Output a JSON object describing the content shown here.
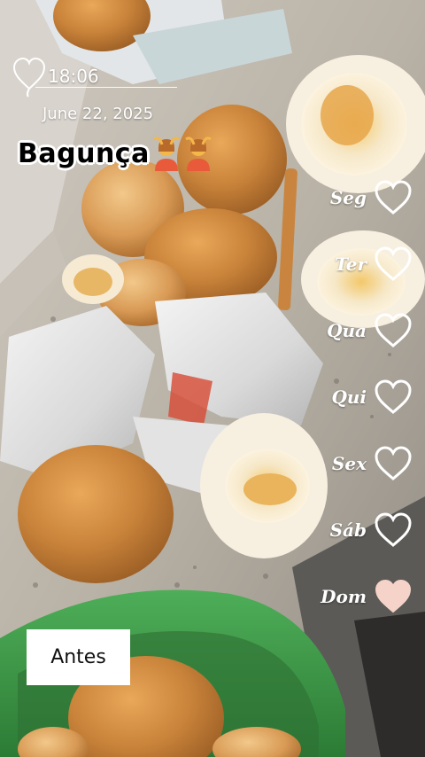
{
  "clock": {
    "time": "18:06",
    "date": "June 22, 2025"
  },
  "title": {
    "text": "Bagunça",
    "emoji_icon": "person-gesturing-ok-icon",
    "emoji_count": 2
  },
  "days": [
    {
      "label": "Seg",
      "filled": false
    },
    {
      "label": "Ter",
      "filled": false
    },
    {
      "label": "Qua",
      "filled": false
    },
    {
      "label": "Qui",
      "filled": false
    },
    {
      "label": "Sex",
      "filled": false
    },
    {
      "label": "Sáb",
      "filled": false
    },
    {
      "label": "Dom",
      "filled": true
    }
  ],
  "caption": {
    "text": "Antes"
  },
  "colors": {
    "heart_outline": "#ffffff",
    "heart_filled": "#f6d3c8",
    "bucket_green": "#3f9c4a"
  }
}
